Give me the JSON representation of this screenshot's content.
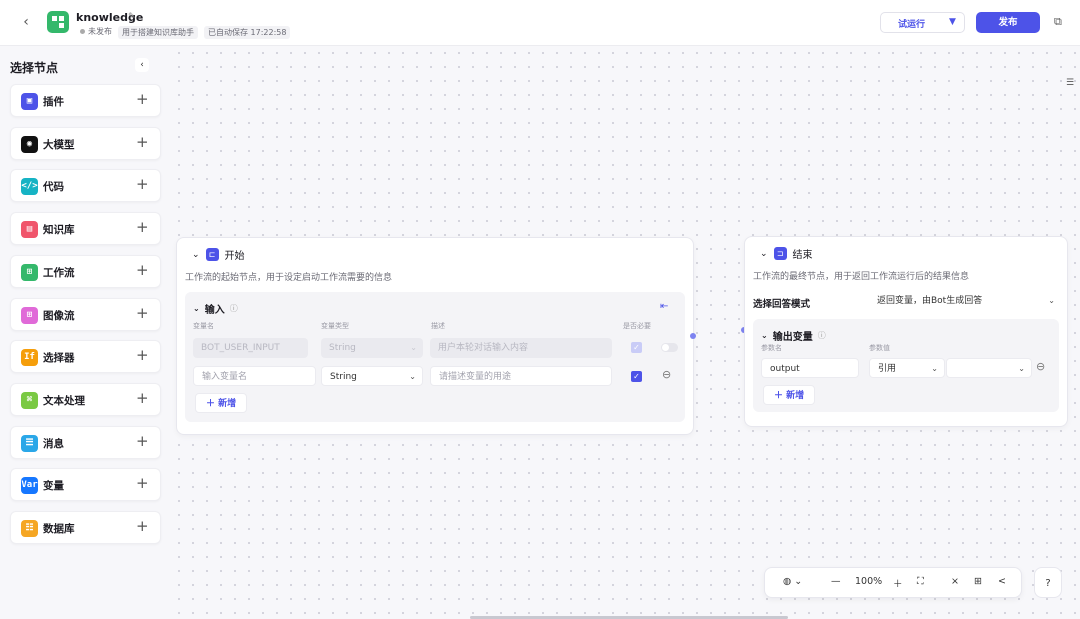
{
  "header": {
    "app_title": "knowledge",
    "status": "未发布",
    "description": "用于搭建知识库助手",
    "autosave": "已自动保存 17:22:58",
    "run_label": "试运行",
    "publish_label": "发布"
  },
  "sidebar": {
    "title": "选择节点",
    "items": [
      {
        "label": "插件",
        "color": "#4d53e8",
        "icon": "plugin-icon",
        "glyph": "▣"
      },
      {
        "label": "大模型",
        "color": "#111111",
        "icon": "llm-icon",
        "glyph": "◉"
      },
      {
        "label": "代码",
        "color": "#16b3c4",
        "icon": "code-icon",
        "glyph": "</>"
      },
      {
        "label": "知识库",
        "color": "#f0556b",
        "icon": "knowledge-icon",
        "glyph": "▤"
      },
      {
        "label": "工作流",
        "color": "#34b86b",
        "icon": "workflow-icon",
        "glyph": "⊞"
      },
      {
        "label": "图像流",
        "color": "#e06ad8",
        "icon": "imageflow-icon",
        "glyph": "⊞"
      },
      {
        "label": "选择器",
        "color": "#f59e0b",
        "icon": "selector-icon",
        "glyph": "If"
      },
      {
        "label": "文本处理",
        "color": "#7ac943",
        "icon": "text-process-icon",
        "glyph": "⌘"
      },
      {
        "label": "消息",
        "color": "#2aa7e8",
        "icon": "message-icon",
        "glyph": "☰"
      },
      {
        "label": "变量",
        "color": "#1677ff",
        "icon": "variable-icon",
        "glyph": "Var"
      },
      {
        "label": "数据库",
        "color": "#f5a623",
        "icon": "database-icon",
        "glyph": "☷"
      }
    ]
  },
  "start_node": {
    "title": "开始",
    "description": "工作流的起始节点，用于设定启动工作流需要的信息",
    "input_title": "输入",
    "col_name": "变量名",
    "col_type": "变量类型",
    "col_desc": "描述",
    "col_required": "是否必要",
    "row1": {
      "name": "BOT_USER_INPUT",
      "type": "String",
      "desc": "用户本轮对话输入内容"
    },
    "row2": {
      "name_placeholder": "输入变量名",
      "type": "String",
      "desc_placeholder": "请描述变量的用途"
    },
    "add_label": "新增"
  },
  "end_node": {
    "title": "结束",
    "description": "工作流的最终节点，用于返回工作流运行后的结果信息",
    "mode_label": "选择回答模式",
    "mode_value": "返回变量，由Bot生成回答",
    "output_title": "输出变量",
    "col_name": "参数名",
    "col_value": "参数值",
    "row1": {
      "name": "output",
      "ref": "引用",
      "value": ""
    },
    "add_label": "新增"
  },
  "toolbar": {
    "zoom": "100%"
  }
}
